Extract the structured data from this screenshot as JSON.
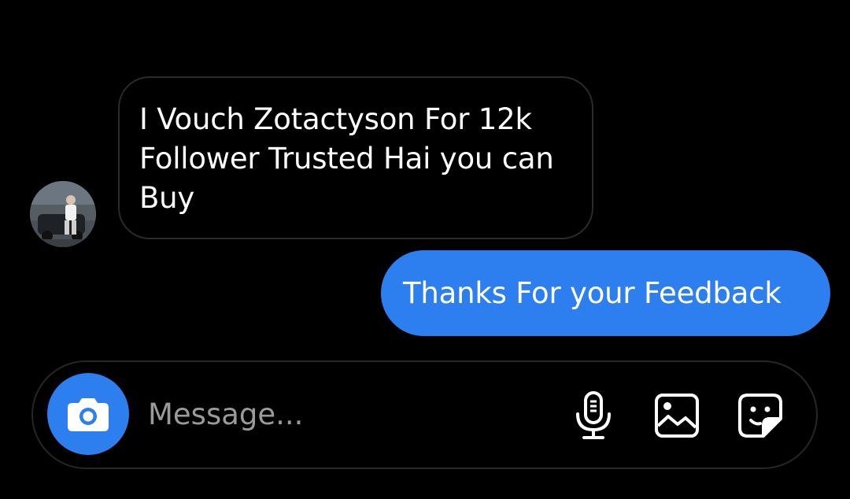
{
  "conversation": {
    "incoming_message": {
      "text": "I Vouch Zotactyson For 12k Follower Trusted Hai you can Buy"
    },
    "outgoing_message": {
      "text": "Thanks For your Feedback"
    }
  },
  "composer": {
    "placeholder": "Message...",
    "icons": [
      "camera-icon",
      "microphone-icon",
      "gallery-icon",
      "sticker-icon"
    ]
  },
  "colors": {
    "background": "#000000",
    "accent_blue": "#2d7ff0",
    "bubble_border": "#2b2b2b",
    "placeholder": "#9a9a9a"
  }
}
